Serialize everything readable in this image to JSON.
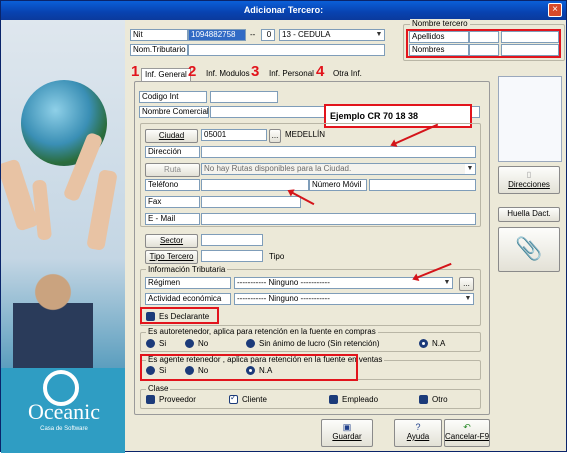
{
  "window": {
    "title": "Adicionar Tercero:",
    "close": "×"
  },
  "logo": {
    "name": "Oceanic",
    "tagline": "Casa de Software"
  },
  "ident": {
    "nit_label": "Nit",
    "nit_value": "1094882758",
    "dash": "--",
    "dv": "0",
    "doctype": "13 - CEDULA",
    "nom_tributario_label": "Nom.Tributario"
  },
  "nombre_tercero": {
    "title": "Nombre tercero",
    "apellidos": "Apellidos",
    "nombres": "Nombres"
  },
  "tabs": {
    "t1_num": "1",
    "t1": "Inf. General",
    "t2_num": "2",
    "t2": "Inf. Modulos",
    "t3_num": "3",
    "t3": "Inf. Personal",
    "t4_num": "4",
    "t4": "Otra Inf."
  },
  "general": {
    "codigo_int": "Codigo Int",
    "nombre_comercial": "Nombre Comercial",
    "callout": "Ejemplo CR 70 18 38",
    "ciudad_btn": "Ciudad",
    "ciudad_code": "05001",
    "ciudad_more": "...",
    "ciudad_name": "MEDELLÍN",
    "direccion": "Dirección",
    "ruta_btn": "Ruta",
    "ruta_value": "No hay Rutas disponibles para la Ciudad.",
    "telefono": "Teléfono",
    "numero_movil": "Número Móvil",
    "fax": "Fax",
    "email": "E - Mail",
    "sector_btn": "Sector",
    "tipo_tercero_btn": "Tipo Tercero",
    "tipo": "Tipo"
  },
  "tributaria": {
    "title": "Información Tributaria",
    "regimen": "Régimen",
    "regimen_value": "----------- Ninguno -----------",
    "regimen_more": "...",
    "actividad": "Actividad económica",
    "actividad_value": "----------- Ninguno -----------",
    "declarante": "Es Declarante"
  },
  "autoretenedor": {
    "title": "Es autoretenedor, aplica para retención en la fuente en compras",
    "si": "Si",
    "no": "No",
    "sin_animo": "Sin ánimo de lucro (Sin retención)",
    "na": "N.A"
  },
  "agente": {
    "title": "Es agente retenedor , aplica para retención en la fuente en ventas",
    "si": "Si",
    "no": "No",
    "na": "N.A"
  },
  "clase": {
    "title": "Clase",
    "proveedor": "Proveedor",
    "cliente": "Cliente",
    "empleado": "Empleado",
    "otro": "Otro"
  },
  "side": {
    "direcciones": "Direcciones",
    "huella": "Huella Dact."
  },
  "footer": {
    "guardar": "Guardar",
    "ayuda": "Ayuda",
    "cancelar": "Cancelar-F9"
  },
  "colors": {
    "title_bar": "#0a4bc4",
    "highlight": "#e2141c",
    "panel": "#ece9d8"
  }
}
